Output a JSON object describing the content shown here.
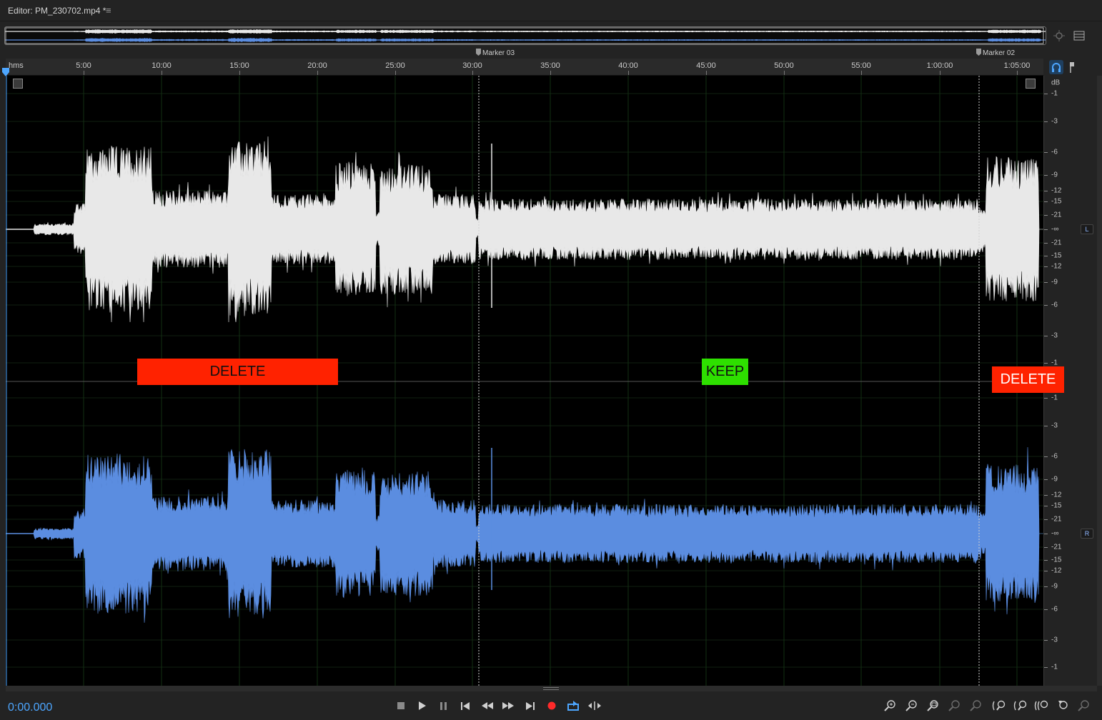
{
  "window": {
    "title": "Editor: PM_230702.mp4 *"
  },
  "ruler": {
    "unit": "hms",
    "ticks": [
      "5:00",
      "10:00",
      "15:00",
      "20:00",
      "25:00",
      "30:00",
      "35:00",
      "40:00",
      "45:00",
      "50:00",
      "55:00",
      "1:00:00",
      "1:05:00"
    ]
  },
  "markers": [
    {
      "label": "Marker 03"
    },
    {
      "label": "Marker 02"
    }
  ],
  "db_scale": {
    "unit": "dB",
    "left_labels": [
      "-1",
      "-3",
      "-6",
      "-9",
      "-12",
      "-15",
      "-21",
      "-∞",
      "-21",
      "-15",
      "-12",
      "-9",
      "-6",
      "-3",
      "-1"
    ],
    "right_labels": [
      "-1",
      "-3",
      "-6",
      "-9",
      "-12",
      "-15",
      "-21",
      "-∞",
      "-21",
      "-15",
      "-12",
      "-9",
      "-6",
      "-3",
      "-1"
    ],
    "left_channel": "L",
    "right_channel": "R"
  },
  "annotations": {
    "delete_1": "DELETE",
    "keep_1": "KEEP",
    "delete_2": "DELETE"
  },
  "transport": {
    "timecode": "0:00.000",
    "buttons": [
      "stop-icon",
      "play-icon",
      "pause-icon",
      "skip-to-start-icon",
      "rewind-icon",
      "fast-forward-icon",
      "skip-to-end-icon",
      "record-icon",
      "loop-playback-icon",
      "skip-selection-icon"
    ]
  },
  "zoom": {
    "buttons": [
      "zoom-in-amplitude-icon",
      "zoom-out-amplitude-icon",
      "zoom-in-time-icon",
      "zoom-out-full-icon",
      "zoom-in-at-in-point-icon",
      "zoom-in-at-out-point-icon",
      "zoom-out-time-icon",
      "zoom-in-left-icon",
      "zoom-in-right-icon",
      "zoom-reset-icon",
      "zoom-full-icon"
    ]
  },
  "colors": {
    "left_channel_wave": "#e8e8e8",
    "right_channel_wave": "#5b8de0",
    "delete_tag": "#ff2200",
    "keep_tag": "#2ee000",
    "timecode": "#4da6ff",
    "record": "#ff2a2a",
    "loop_active": "#4da6ff"
  }
}
